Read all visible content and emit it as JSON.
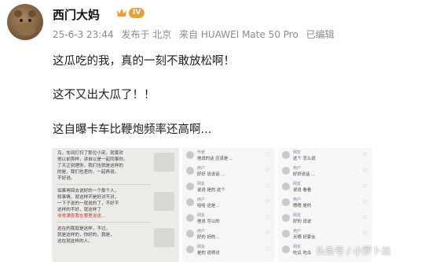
{
  "user": {
    "name": "西门大妈",
    "level": "IV"
  },
  "meta": {
    "date": "25-6-3 23:44",
    "location": "发布于 北京",
    "source": "来自 HUAWEI Mate 50 Pro",
    "edited": "已编辑"
  },
  "post": {
    "line1": "这瓜吃的我，真的一刻不敢放松啊！",
    "line2": "这不又出大瓜了！！",
    "line3": "这自曝卡车比鞭炮频率还高啊..."
  },
  "screenshot_left": {
    "lines": [
      "鸟，车间打扫了那位小宋，就喜欢",
      "他以前那样，讲自以是一起同事你，",
      "了天正别理你，我们也就是这样的",
      "的是，我们也差的，一起再说。",
      "不好说。",
      "如果再回去说好的一个那个人，",
      "和事情，就这样不是好对不对，",
      "一下子说的一就说的了，不好不",
      "这样的不好，就这样了",
      "这在的我就是这样，不过，",
      "就是这样的，你好的，我是，",
      "这在就这样的人。"
    ],
    "highlight": "非常满意我在哪里说说..."
  },
  "comments": [
    {
      "name": "作者",
      "text": "他说的话 应该是…",
      "count": ""
    },
    {
      "name": "用户",
      "text": "好好 说说话 …",
      "count": ""
    },
    {
      "name": "网友",
      "text": "说说 是的 这个",
      "count": ""
    },
    {
      "name": "用户",
      "text": "哈哈 这是…",
      "count": ""
    },
    {
      "name": "网友",
      "text": "他说 可以的",
      "count": ""
    },
    {
      "name": "用户",
      "text": "好的 好的…",
      "count": ""
    },
    {
      "name": "网友",
      "text": "是的 说得对",
      "count": ""
    }
  ],
  "comments2": [
    {
      "name": "网友",
      "text": "这个 怎么说",
      "count": ""
    },
    {
      "name": "用户",
      "text": "好好说话 …",
      "count": ""
    },
    {
      "name": "网友",
      "text": "说说 看看",
      "count": ""
    },
    {
      "name": "用户",
      "text": "嗯嗯 是的",
      "count": ""
    },
    {
      "name": "网友",
      "text": "好的 说说",
      "count": ""
    },
    {
      "name": "用户",
      "text": "天哪 好家伙",
      "count": ""
    },
    {
      "name": "网友",
      "text": "吃瓜 吃瓜",
      "count": ""
    }
  ],
  "watermark": "头条号 / 小罗卜丝",
  "colors": {
    "badge": "#e8a13a",
    "meta": "#8a8a8a",
    "link": "#6f88b3"
  }
}
